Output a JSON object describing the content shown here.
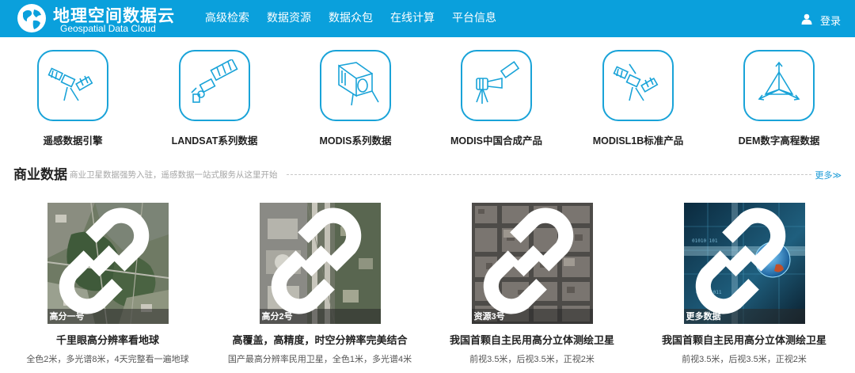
{
  "header": {
    "logo_title": "地理空间数据云",
    "logo_subtitle": "Geospatial Data Cloud",
    "nav": [
      "高级检索",
      "数据资源",
      "数据众包",
      "在线计算",
      "平台信息"
    ],
    "login_label": "登录"
  },
  "products": [
    {
      "label": "遥感数据引擎",
      "icon": "satellite-icon"
    },
    {
      "label": "LANDSAT系列数据",
      "icon": "landsat-satellite-icon"
    },
    {
      "label": "MODIS系列数据",
      "icon": "modis-sensor-icon"
    },
    {
      "label": "MODIS中国合成产品",
      "icon": "modis-china-satellite-icon"
    },
    {
      "label": "MODISL1B标准产品",
      "icon": "modis-l1b-satellite-icon"
    },
    {
      "label": "DEM数字高程数据",
      "icon": "dem-elevation-icon"
    }
  ],
  "commercial": {
    "title": "商业数据",
    "subtitle": "商业卫星数据强势入驻，遥感数据一站式服务从这里开始",
    "more_label": "更多≫",
    "cards": [
      {
        "tag": "高分一号",
        "title": "千里眼高分辨率看地球",
        "desc": "全色2米，多光谱8米，4天完整看一遍地球"
      },
      {
        "tag": "高分2号",
        "title": "高覆盖，高精度，时空分辨率完美结合",
        "desc": "国产最高分辨率民用卫星，全色1米，多光谱4米"
      },
      {
        "tag": "资源3号",
        "title": "我国首颗自主民用高分立体测绘卫星",
        "desc": "前视3.5米，后视3.5米，正视2米"
      },
      {
        "tag": "更多数据",
        "title": "我国首颗自主民用高分立体测绘卫星",
        "desc": "前视3.5米，后视3.5米，正视2米"
      }
    ]
  },
  "colors": {
    "brand_blue": "#0aa0dc",
    "icon_blue": "#19a3d8",
    "link_blue": "#1a9ad6"
  }
}
